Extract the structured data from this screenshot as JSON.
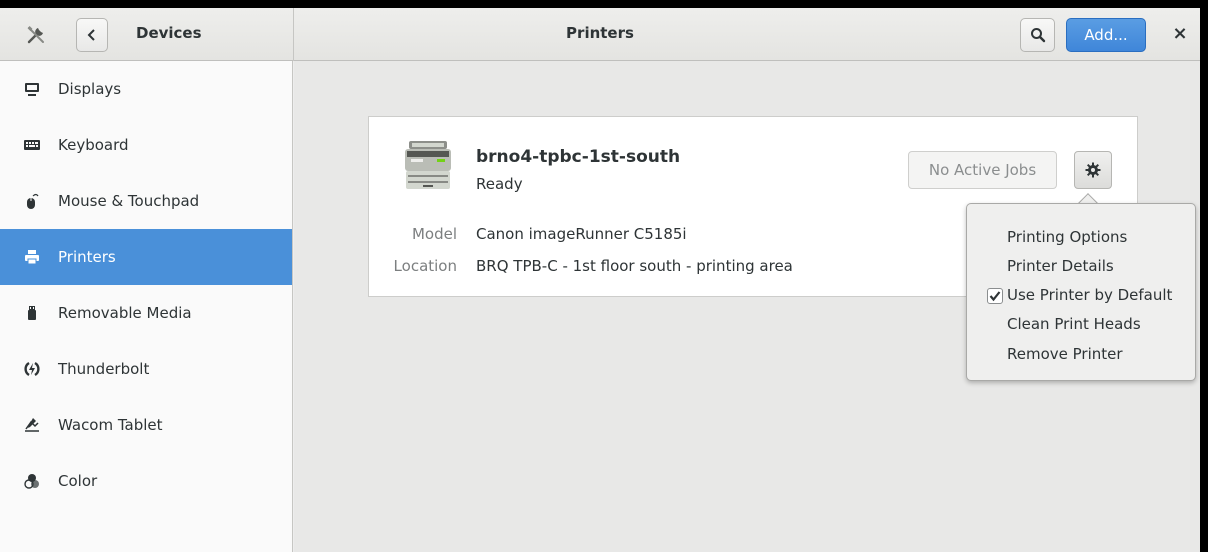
{
  "header": {
    "left_title": "Devices",
    "center_title": "Printers",
    "add_label": "Add...",
    "close_label": "×"
  },
  "sidebar": {
    "items": [
      {
        "label": "Displays",
        "icon": "display-icon"
      },
      {
        "label": "Keyboard",
        "icon": "keyboard-icon"
      },
      {
        "label": "Mouse & Touchpad",
        "icon": "mouse-icon"
      },
      {
        "label": "Printers",
        "icon": "printer-icon",
        "active": true
      },
      {
        "label": "Removable Media",
        "icon": "usb-icon"
      },
      {
        "label": "Thunderbolt",
        "icon": "thunderbolt-icon"
      },
      {
        "label": "Wacom Tablet",
        "icon": "tablet-icon"
      },
      {
        "label": "Color",
        "icon": "color-icon"
      }
    ]
  },
  "printer": {
    "name": "brno4-tpbc-1st-south",
    "status": "Ready",
    "jobs_label": "No Active Jobs",
    "model_label": "Model",
    "model_value": "Canon imageRunner C5185i",
    "location_label": "Location",
    "location_value": "BRQ TPB-C - 1st floor south - printing area"
  },
  "menu": {
    "items": [
      {
        "label": "Printing Options"
      },
      {
        "label": "Printer Details"
      },
      {
        "label": "Use Printer by Default",
        "checked": true
      },
      {
        "label": "Clean Print Heads"
      },
      {
        "label": "Remove Printer"
      }
    ]
  },
  "colors": {
    "accent": "#4a90d9",
    "add_button": "#3f86d9"
  }
}
